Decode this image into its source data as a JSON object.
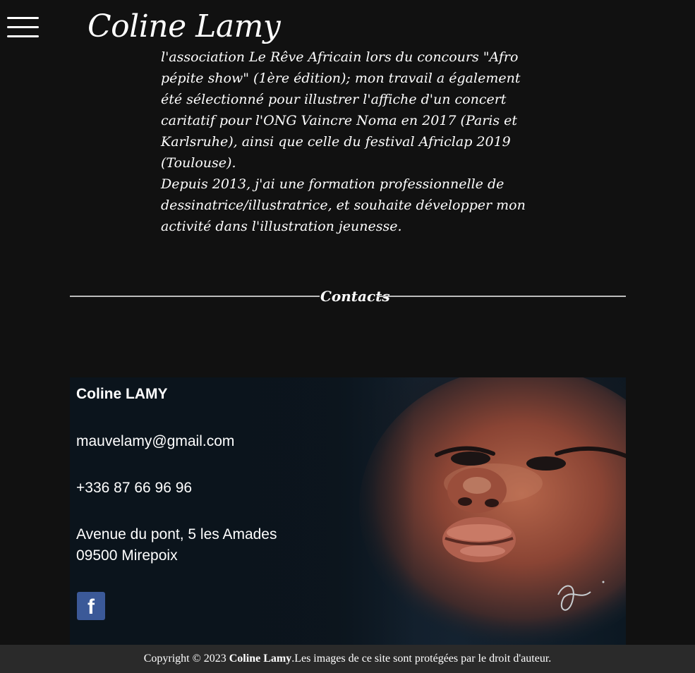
{
  "header": {
    "logo_text": "Coline Lamy"
  },
  "bio": {
    "paragraph_1": "l'association Le Rêve Africain lors du concours \"Afro pépite show\" (1ère édition); mon travail a également été sélectionné pour illustrer l'affiche d'un concert caritatif pour l'ONG Vaincre Noma en 2017 (Paris et Karlsruhe), ainsi que celle du festival Africlap 2019 (Toulouse).",
    "paragraph_2": "Depuis 2013, j'ai une formation professionnelle de dessinatrice/illustratrice, et souhaite développer mon activité dans l'illustration jeunesse."
  },
  "contacts": {
    "section_title": "Contacts",
    "name": "Coline LAMY",
    "email": "mauvelamy@gmail.com",
    "phone": "+336 87 66 96 96",
    "address_line_1": "Avenue du pont, 5 les Amades",
    "address_line_2": "09500 Mirepoix",
    "facebook_icon": "facebook-icon",
    "facebook_glyph": "f"
  },
  "footer": {
    "copyright_prefix": "Copyright © 2023 ",
    "copyright_name": "Coline Lamy",
    "copyright_suffix": ".Les images de ce site sont protégées par le droit d'auteur."
  },
  "colors": {
    "background": "#111111",
    "footer_background": "#2a2a2a",
    "divider": "#bdbdbd",
    "facebook_blue": "#3b5998"
  }
}
